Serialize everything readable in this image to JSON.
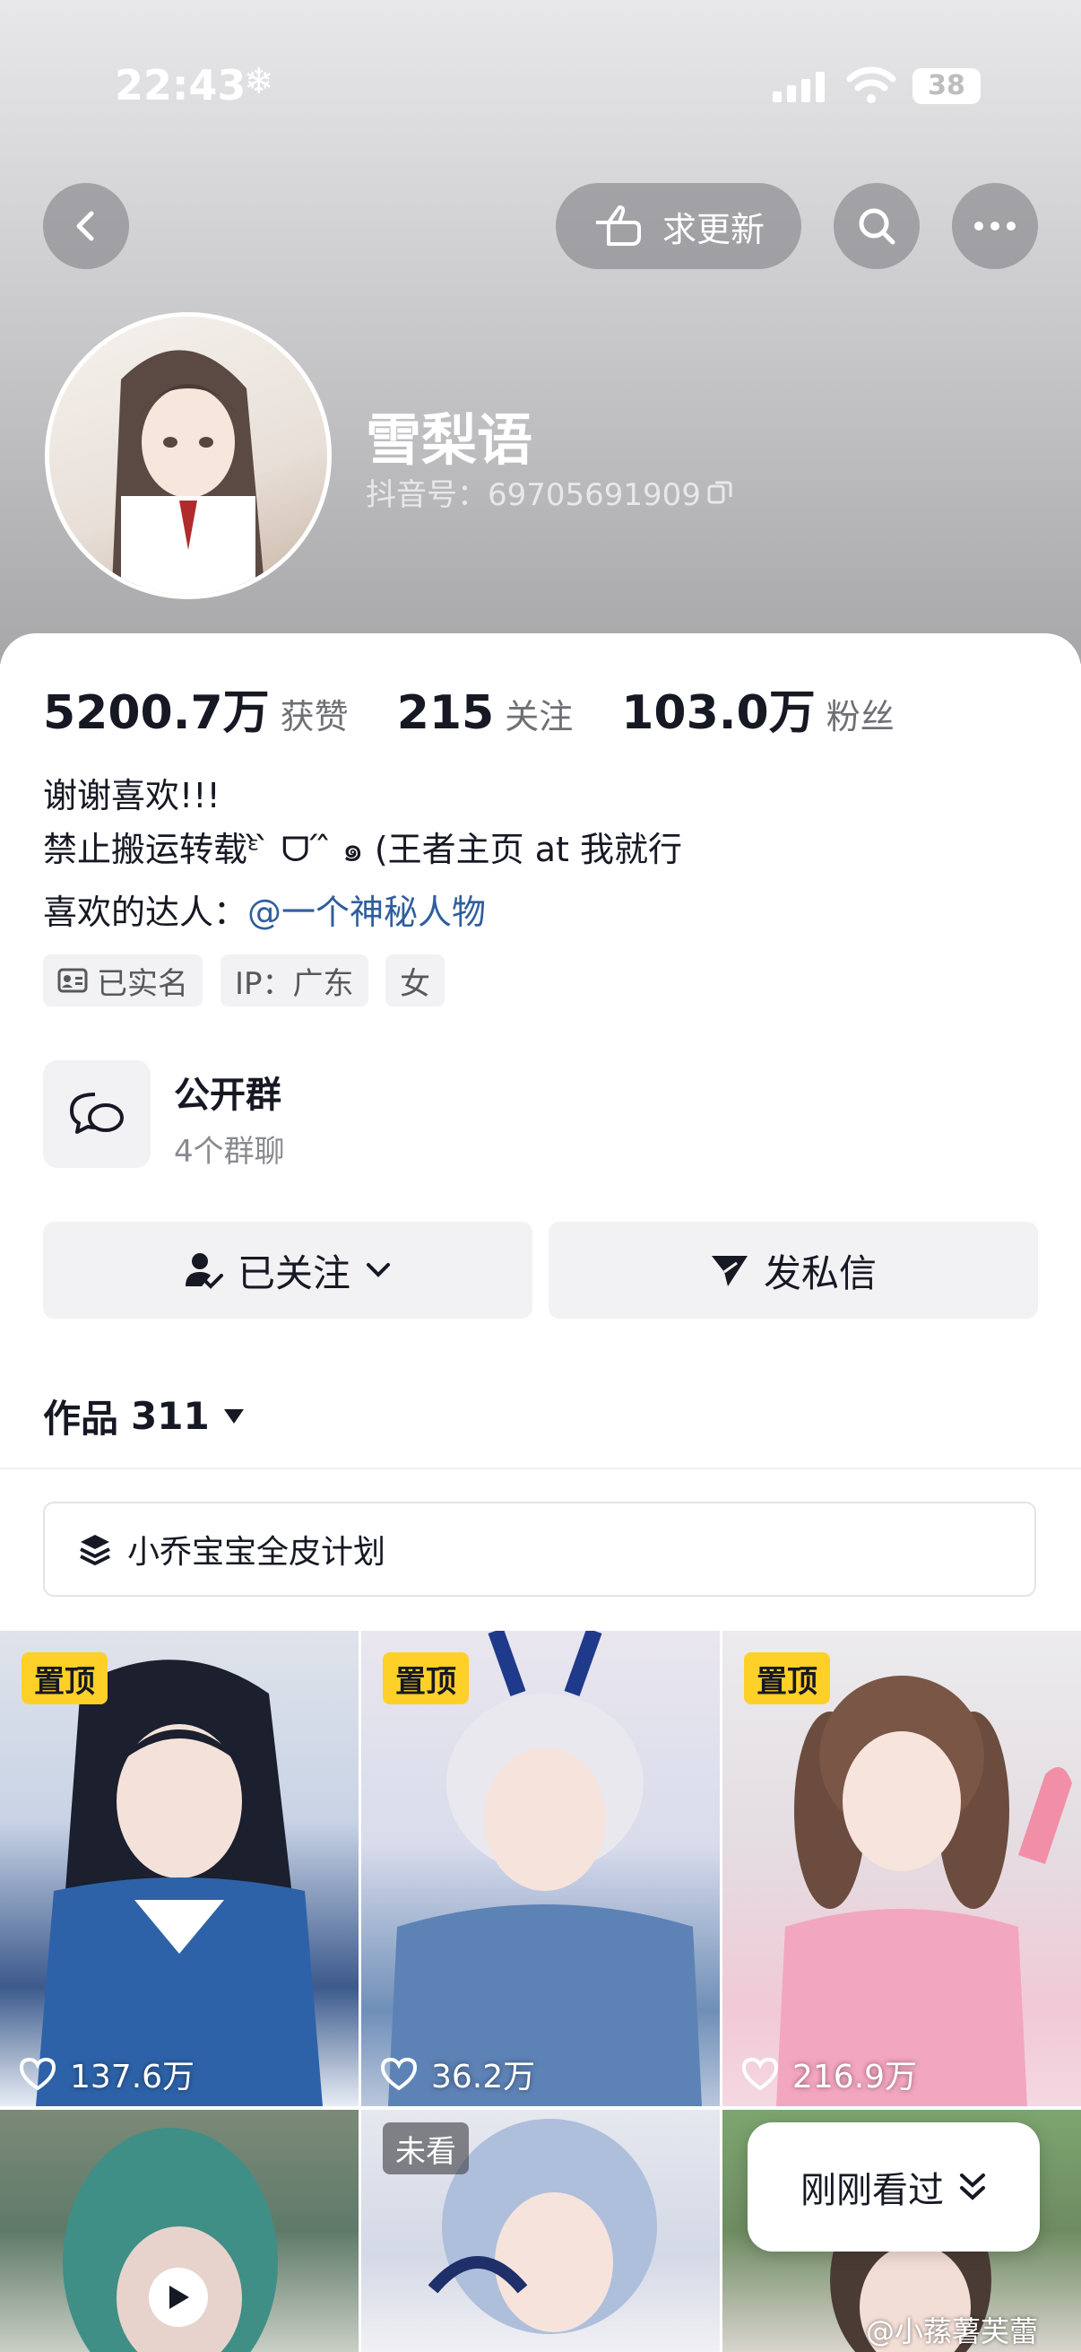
{
  "status_bar": {
    "time": "22:43",
    "battery": "38"
  },
  "header": {
    "update_label": "求更新"
  },
  "profile": {
    "nickname": "雪梨语",
    "douyin_id": "抖音号：69705691909"
  },
  "stats": [
    {
      "value": "5200.7万",
      "label": "获赞"
    },
    {
      "value": "215",
      "label": "关注"
    },
    {
      "value": "103.0万",
      "label": "粉丝"
    }
  ],
  "bio": {
    "line1": "谢谢喜欢!!!",
    "line2": "禁止搬运转载ᵋ̀ ̀ ᗜ ́ ̂ ๑ (王者主页 at 我就行",
    "liked_prefix": "喜欢的达人：",
    "liked_user": "@一个神秘人物"
  },
  "tags": [
    "已实名",
    "IP：广东",
    "女"
  ],
  "group": {
    "title": "公开群",
    "subtitle": "4个群聊"
  },
  "buttons": {
    "followed": "已关注",
    "message": "发私信"
  },
  "works": {
    "label": "作品",
    "count": "311"
  },
  "collection": {
    "title": "小乔宝宝全皮计划"
  },
  "videos": [
    {
      "badge": "置顶",
      "likes": "137.6万"
    },
    {
      "badge": "置顶",
      "likes": "36.2万"
    },
    {
      "badge": "置顶",
      "likes": "216.9万"
    },
    {
      "badge": "",
      "likes": ""
    },
    {
      "badge": "未看",
      "likes": ""
    },
    {
      "badge": "",
      "likes": ""
    }
  ],
  "recently_viewed": "刚刚看过",
  "watermark": "@小蓀薯芙蕾"
}
